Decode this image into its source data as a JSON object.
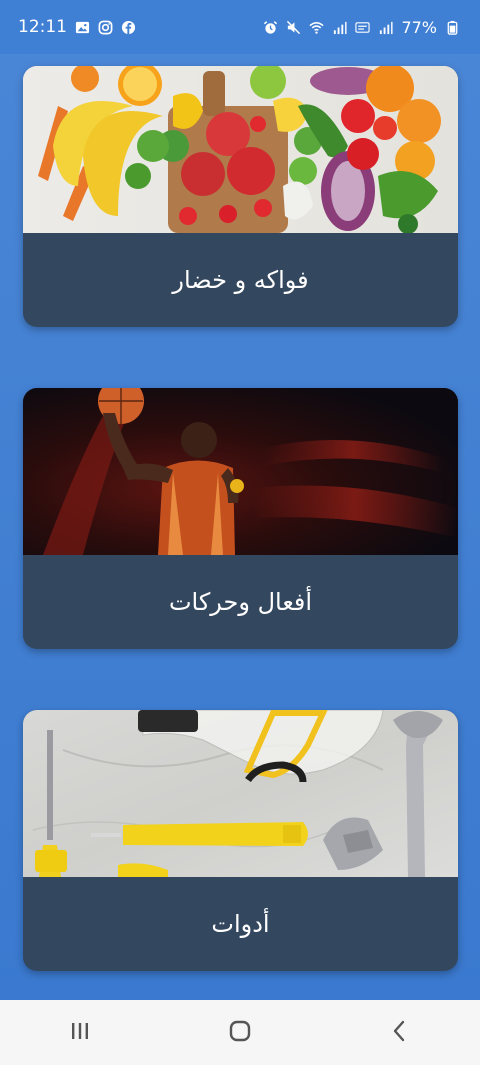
{
  "status_bar": {
    "time": "12:11",
    "battery": "77%",
    "left_icons": [
      "image-icon",
      "instagram-icon",
      "facebook-icon"
    ],
    "right_icons": [
      "alarm-icon",
      "mute-icon",
      "wifi-icon",
      "signal-icon",
      "volte-icon",
      "signal2-icon",
      "battery-icon"
    ]
  },
  "categories": [
    {
      "label": "فواكه و خضار",
      "image": "fruits-vegetables-image"
    },
    {
      "label": "أفعال وحركات",
      "image": "basketball-player-image"
    },
    {
      "label": "أدوات",
      "image": "tools-image"
    }
  ],
  "nav_bar": {
    "buttons": [
      "recent-apps-icon",
      "home-icon",
      "back-icon"
    ]
  },
  "colors": {
    "background": "#3f7fd4",
    "card_label_bg": "#33475f",
    "nav_bg": "#f6f6f6"
  }
}
